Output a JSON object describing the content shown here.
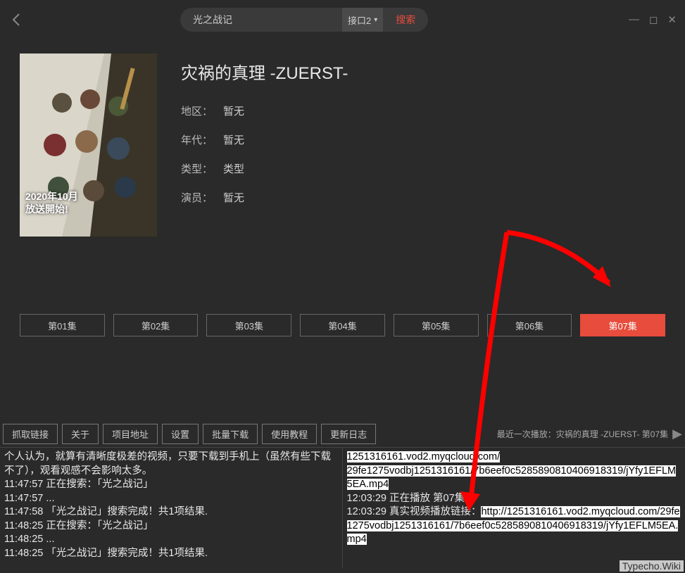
{
  "search": {
    "value": "光之战记",
    "interface": "接口2",
    "searchLabel": "搜索"
  },
  "media": {
    "title": "灾祸的真理 -ZUERST-",
    "regionLabel": "地区：",
    "regionValue": "暂无",
    "yearLabel": "年代：",
    "yearValue": "暂无",
    "typeLabel": "类型：",
    "typeValue": "类型",
    "castLabel": "演员：",
    "castValue": "暂无",
    "posterLine1": "2020年10月",
    "posterLine2": "放送開始!"
  },
  "episodes": [
    "第01集",
    "第02集",
    "第03集",
    "第04集",
    "第05集",
    "第06集",
    "第07集"
  ],
  "activeEpisode": 6,
  "tabs": [
    "抓取链接",
    "关于",
    "项目地址",
    "设置",
    "批量下载",
    "使用教程",
    "更新日志"
  ],
  "recent": {
    "prefix": "最近一次播放：",
    "text": "灾祸的真理 -ZUERST-  第07集"
  },
  "logLeft": [
    "个人认为，就算有清晰度极差的视频，只要下载到手机上（虽然有些下载不了），观看观感不会影响太多。",
    "11:47:57 正在搜索：「光之战记」",
    "11:47:57 ...",
    "11:47:58 「光之战记」搜索完成！共1项结果.",
    "11:48:25 正在搜索：「光之战记」",
    "11:48:25 ...",
    "11:48:25 「光之战记」搜索完成！共1项结果."
  ],
  "logRight": {
    "line1a": "1251316161.vod2.myqcloud.com/",
    "line1b": "29fe1275vodbj1251316161/7b6eef0c5285890810406918319/jYfy1EFLM5EA.mp4",
    "line2": "12:03:29 正在播放   第07集",
    "line3pre": "12:03:29 真实视频播放链接：",
    "line3hl": "http://1251316161.vod2.myqcloud.com/29fe1275vodbj1251316161/7b6eef0c5285890810406918319/jYfy1EFLM5EA.mp4"
  },
  "watermark": "Typecho.Wiki"
}
